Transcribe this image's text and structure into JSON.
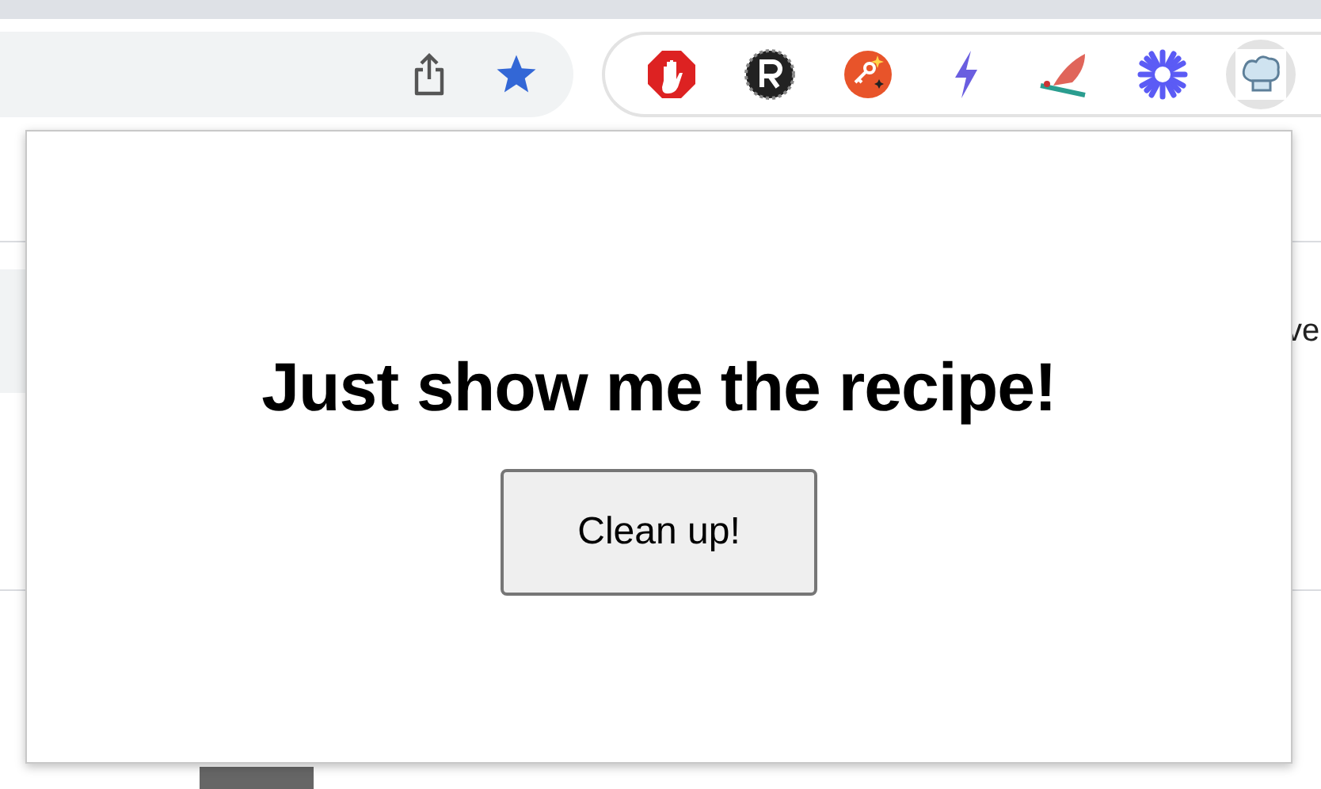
{
  "toolbar": {
    "extensions": [
      {
        "kind": "stop-hand",
        "selected": false
      },
      {
        "kind": "r-badge",
        "selected": false
      },
      {
        "kind": "sparkle-key",
        "selected": false
      },
      {
        "kind": "bolt",
        "selected": false
      },
      {
        "kind": "wing",
        "selected": false
      },
      {
        "kind": "asterisk",
        "selected": false
      },
      {
        "kind": "chef-hat",
        "selected": true
      }
    ]
  },
  "page": {
    "side_text": "ve"
  },
  "popup": {
    "heading": "Just show me the recipe!",
    "button": "Clean up!"
  }
}
